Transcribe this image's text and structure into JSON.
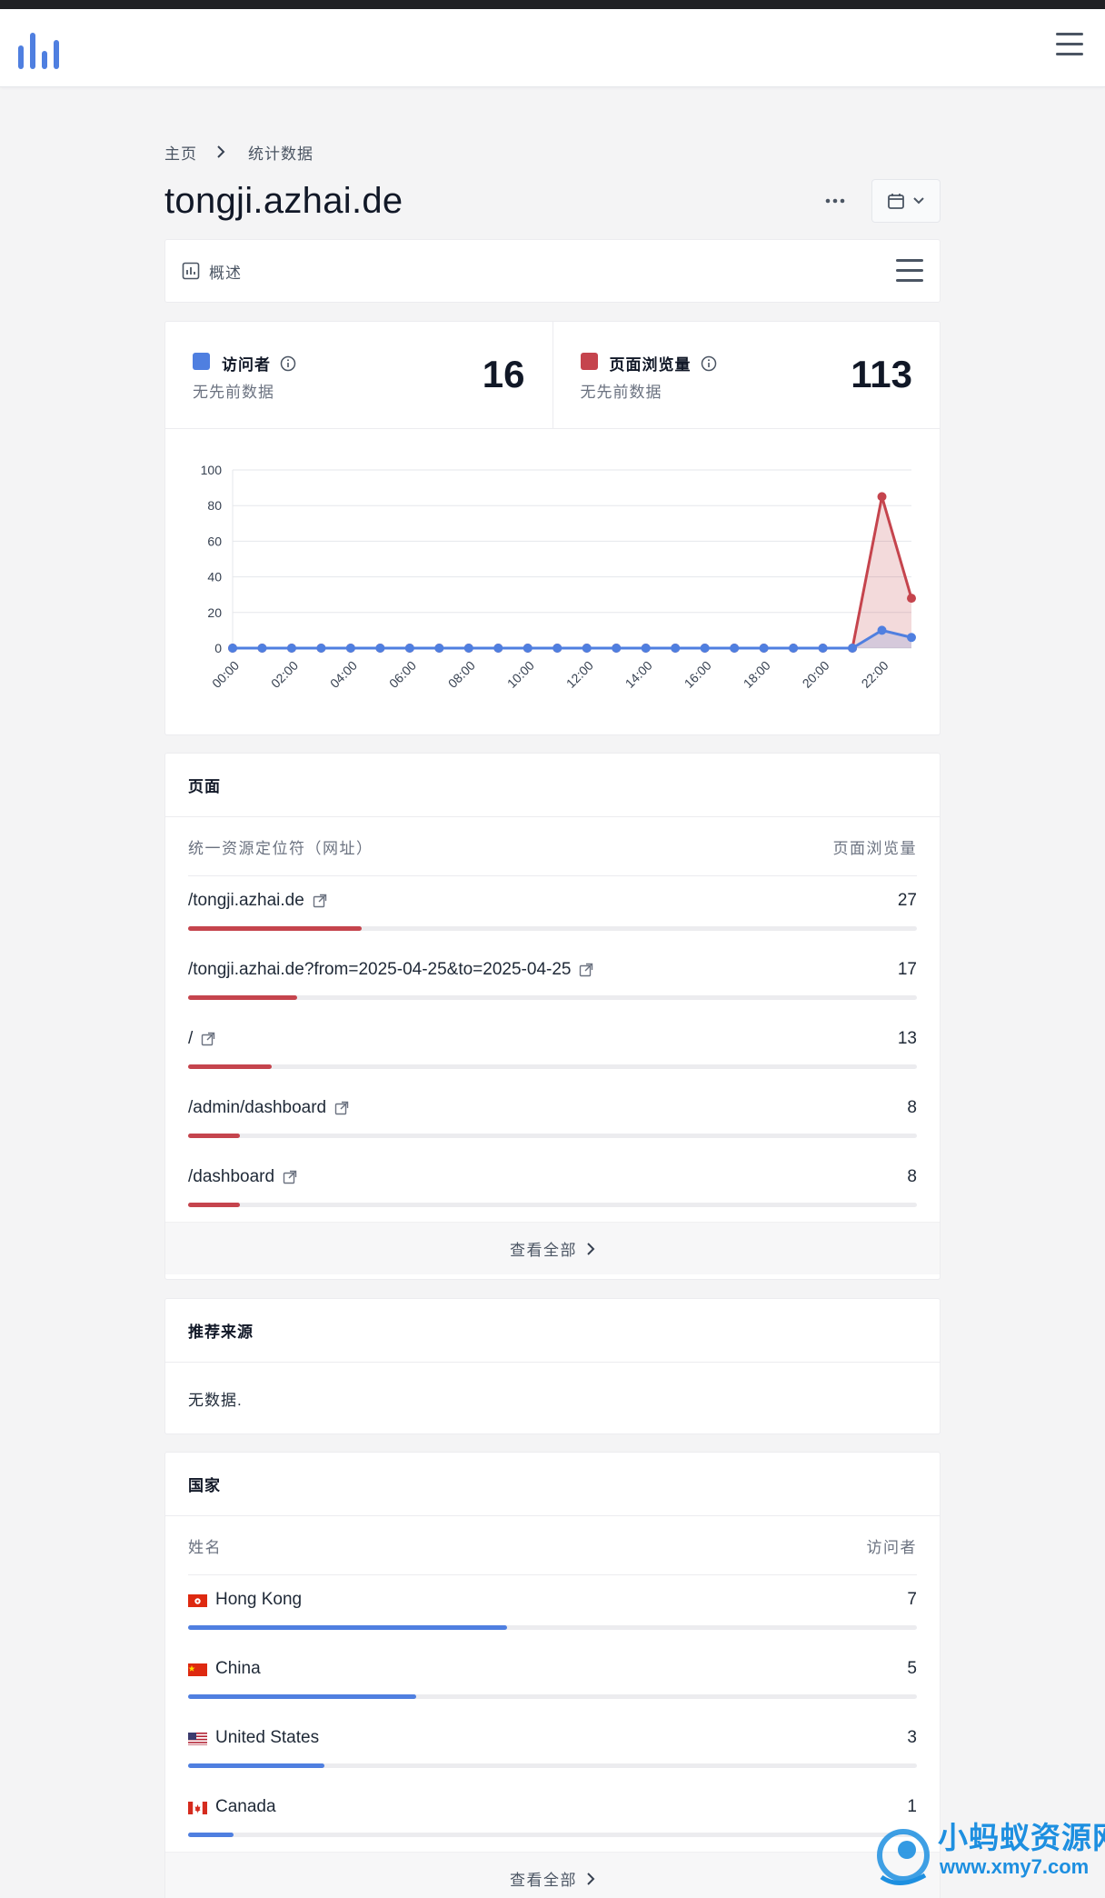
{
  "colors": {
    "visitors": "#4f7fe0",
    "pageviews": "#c5444d",
    "accent": "#4f7fe0"
  },
  "header": {
    "logo_icon": "bar-chart-logo-icon",
    "menu_icon": "hamburger-menu-icon"
  },
  "breadcrumb": {
    "home": "主页",
    "current": "统计数据"
  },
  "site": {
    "title": "tongji.azhai.de"
  },
  "tabs": {
    "overview": "概述"
  },
  "stats": {
    "visitors": {
      "label": "访问者",
      "sub": "无先前数据",
      "value": "16"
    },
    "pageviews": {
      "label": "页面浏览量",
      "sub": "无先前数据",
      "value": "113"
    }
  },
  "chart_data": {
    "type": "line",
    "x": [
      "00:00",
      "01:00",
      "02:00",
      "03:00",
      "04:00",
      "05:00",
      "06:00",
      "07:00",
      "08:00",
      "09:00",
      "10:00",
      "11:00",
      "12:00",
      "13:00",
      "14:00",
      "15:00",
      "16:00",
      "17:00",
      "18:00",
      "19:00",
      "20:00",
      "21:00",
      "22:00",
      "23:00"
    ],
    "x_tick_labels": [
      "00:00",
      "02:00",
      "04:00",
      "06:00",
      "08:00",
      "10:00",
      "12:00",
      "14:00",
      "16:00",
      "18:00",
      "20:00",
      "22:00"
    ],
    "series": [
      {
        "name": "页面浏览量",
        "color": "#c5444d",
        "values": [
          0,
          0,
          0,
          0,
          0,
          0,
          0,
          0,
          0,
          0,
          0,
          0,
          0,
          0,
          0,
          0,
          0,
          0,
          0,
          0,
          0,
          0,
          85,
          28
        ]
      },
      {
        "name": "访问者",
        "color": "#4f7fe0",
        "values": [
          0,
          0,
          0,
          0,
          0,
          0,
          0,
          0,
          0,
          0,
          0,
          0,
          0,
          0,
          0,
          0,
          0,
          0,
          0,
          0,
          0,
          0,
          10,
          6
        ]
      }
    ],
    "ylim": [
      0,
      100
    ],
    "y_ticks": [
      0,
      20,
      40,
      60,
      80,
      100
    ],
    "grid": true,
    "title": "",
    "xlabel": "",
    "ylabel": ""
  },
  "pages": {
    "title": "页面",
    "col_left": "统一资源定位符（网址）",
    "col_right": "页面浏览量",
    "rows": [
      {
        "label": "/tongji.azhai.de",
        "value": "27",
        "fraction": 0.238
      },
      {
        "label": "/tongji.azhai.de?from=2025-04-25&to=2025-04-25",
        "value": "17",
        "fraction": 0.15
      },
      {
        "label": "/",
        "value": "13",
        "fraction": 0.115
      },
      {
        "label": "/admin/dashboard",
        "value": "8",
        "fraction": 0.071
      },
      {
        "label": "/dashboard",
        "value": "8",
        "fraction": 0.071
      }
    ],
    "view_all": "查看全部"
  },
  "referrers": {
    "title": "推荐来源",
    "empty": "无数据."
  },
  "countries": {
    "title": "国家",
    "col_left": "姓名",
    "col_right": "访问者",
    "rows": [
      {
        "label": "Hong Kong",
        "value": "7",
        "fraction": 0.4375,
        "flag": "hk"
      },
      {
        "label": "China",
        "value": "5",
        "fraction": 0.3125,
        "flag": "cn"
      },
      {
        "label": "United States",
        "value": "3",
        "fraction": 0.1875,
        "flag": "us"
      },
      {
        "label": "Canada",
        "value": "1",
        "fraction": 0.0625,
        "flag": "ca"
      }
    ],
    "view_all": "查看全部"
  },
  "watermark": {
    "line1": "小蚂蚁资源网",
    "line2": "www.xmy7.com"
  }
}
